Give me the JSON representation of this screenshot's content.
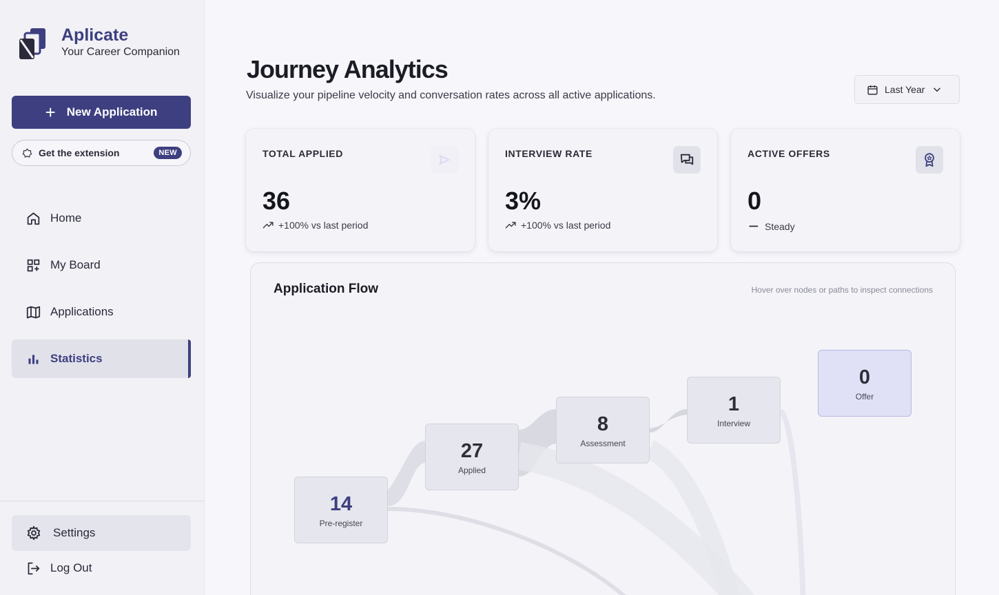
{
  "brand": {
    "name": "Aplicate",
    "tagline": "Your Career Companion"
  },
  "sidebar": {
    "new_button": "New Application",
    "extension_button": "Get the extension",
    "extension_badge": "NEW",
    "items": [
      {
        "label": "Home",
        "icon": "home-icon"
      },
      {
        "label": "My Board",
        "icon": "board-icon"
      },
      {
        "label": "Applications",
        "icon": "map-icon"
      },
      {
        "label": "Statistics",
        "icon": "bar-chart-icon",
        "active": true
      }
    ],
    "settings": "Settings",
    "logout": "Log Out"
  },
  "header": {
    "title": "Journey Analytics",
    "subtitle": "Visualize your pipeline velocity and conversation rates across all active applications.",
    "range": "Last Year"
  },
  "stats": [
    {
      "label": "TOTAL APPLIED",
      "value": "36",
      "trend": "+100% vs last period",
      "icon": "send-icon"
    },
    {
      "label": "INTERVIEW RATE",
      "value": "3%",
      "trend": "+100% vs last period",
      "icon": "chat-icon"
    },
    {
      "label": "ACTIVE OFFERS",
      "value": "0",
      "trend": "Steady",
      "icon": "award-icon"
    }
  ],
  "flow": {
    "title": "Application Flow",
    "hint": "Hover over nodes or paths to inspect connections",
    "nodes": [
      {
        "value": "14",
        "label": "Pre-register"
      },
      {
        "value": "27",
        "label": "Applied"
      },
      {
        "value": "8",
        "label": "Assessment"
      },
      {
        "value": "1",
        "label": "Interview"
      },
      {
        "value": "0",
        "label": "Offer"
      }
    ]
  },
  "colors": {
    "accent": "#3d3f80",
    "background": "#f6f6fb",
    "offer_node": "#e0e1f7"
  }
}
